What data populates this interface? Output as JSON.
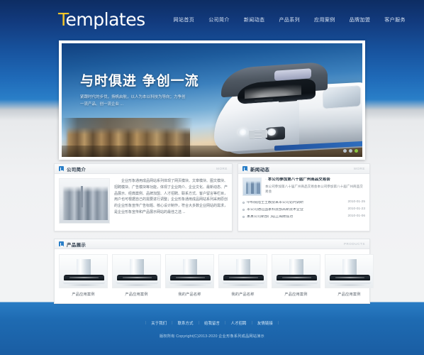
{
  "header": {
    "logo_accent": "T",
    "logo_rest": "emplates",
    "nav": [
      {
        "label": "网站首页"
      },
      {
        "label": "公司简介"
      },
      {
        "label": "新闻动态"
      },
      {
        "label": "产品系列"
      },
      {
        "label": "应用案例"
      },
      {
        "label": "品牌加盟"
      },
      {
        "label": "客户服务"
      }
    ]
  },
  "hero": {
    "title": "与时俱进  争创一流",
    "subtitle": "紧跟时代的步伐，扬帆启航，以人为本以科技为导向；力争创一流产品、创一流企业 ..."
  },
  "company": {
    "title": "公司简介",
    "more": "MORE",
    "text": "企业形象通用成品网站系列体现了网页模块、文章模块、图文模块、招聘模块、广告模块等功能，体现了企业简介、企业文化、最新动态、产品展示、经典案例、品牌加盟、人才招聘、联系方式、客户留言等栏目，用户也可根据自己的需要进行调整；企业形象通用成品网站系列采用原创的企业形象宣传广告标题、核心设计制作，符合大多数企业网站的需求，是企业形象宣传和产品展示网站的最佳之选 ..."
  },
  "news": {
    "title": "新闻动态",
    "more": "MORE",
    "featured": {
      "headline": "本公司参加第八十届广州商品交易会",
      "desc": "本公司参加第八十届广州商品交易会本公司参加第八十届广州商品交易会"
    },
    "items": [
      {
        "title": "中科院陆士王教授来本公司访问调研",
        "date": "2010-01-25"
      },
      {
        "title": "本公司通过国家科技部高新技术企业",
        "date": "2010-01-23"
      },
      {
        "title": "某某公司新部门站立揭牌成功",
        "date": "2010-01-06"
      }
    ]
  },
  "products": {
    "title": "产品展示",
    "more": "PRODUCTS",
    "items": [
      {
        "label": "产品应用案例"
      },
      {
        "label": "产品应用案例"
      },
      {
        "label": "我的产品名称"
      },
      {
        "label": "我的产品名称"
      },
      {
        "label": "产品应用案例"
      },
      {
        "label": "产品应用案例"
      }
    ]
  },
  "footer": {
    "links": [
      {
        "label": "关于我们"
      },
      {
        "label": "联系方式"
      },
      {
        "label": "给我留言"
      },
      {
        "label": "人才招聘"
      },
      {
        "label": "友情链接"
      }
    ],
    "copyright": "版权所有 Copyright(C)2013-2020 企业形象系列成品网站演示"
  },
  "colors": {
    "brand_blue": "#1a5da3",
    "accent_yellow": "#f2c52a",
    "panel_bg": "#ffffff",
    "page_bg": "#f2f3f4"
  }
}
